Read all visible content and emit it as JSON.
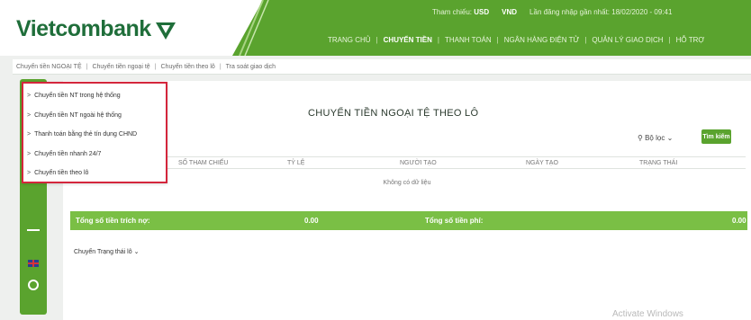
{
  "brand": {
    "name": "Vietcombank",
    "green": "#5aa32e",
    "dark_green": "#1f6e3a",
    "highlight_red": "#d4263c"
  },
  "header": {
    "info": {
      "ref_label": "Tham chiếu:",
      "ref_value": "USD",
      "unit": "VND",
      "last_login": "Lần đăng nhập gần nhất: 18/02/2020 - 09:41"
    },
    "nav": [
      "TRANG CHỦ",
      "CHUYỂN TIỀN",
      "THANH TOÁN",
      "NGÂN HÀNG ĐIỆN TỬ",
      "QUẢN LÝ GIAO DỊCH",
      "HỖ TRỢ"
    ]
  },
  "breadcrumb": [
    "Chuyển tiền NGOẠI TỆ",
    "Chuyển tiền ngoại tệ",
    "Chuyển tiền theo lô",
    "Tra soát giao dịch"
  ],
  "dropdown_items": [
    "Chuyển tiền NT trong hệ thống",
    "Chuyển tiền NT ngoài hệ thống",
    "Thanh toán bằng thẻ tín dụng CHND",
    "Chuyển tiền nhanh 24/7",
    "Chuyển tiền theo lô"
  ],
  "main": {
    "title": "CHUYỂN TIỀN NGOẠI TỆ THEO LÔ",
    "filter_label": "Bộ lọc",
    "search_label": "Tìm kiếm",
    "columns": [
      "SỐ THAM CHIẾU",
      "TỶ LỆ",
      "NGƯỜI TẠO",
      "NGÀY TẠO",
      "TRẠNG THÁI"
    ],
    "empty_text": "Không có dữ liệu",
    "total_label": "Tổng số tiền trích nợ:",
    "total_value": "0.00",
    "fee_label": "Tổng số tiền phí:",
    "fee_value": "0.00",
    "rate_note": "Chuyển Trạng thái lô"
  },
  "watermark": "Activate Windows",
  "icons": {
    "logo": "vietcombank-logo-icon",
    "flag": "uk-flag-icon",
    "circle": "power-icon",
    "chevron": "chevron-right-icon",
    "filter": "filter-icon"
  }
}
